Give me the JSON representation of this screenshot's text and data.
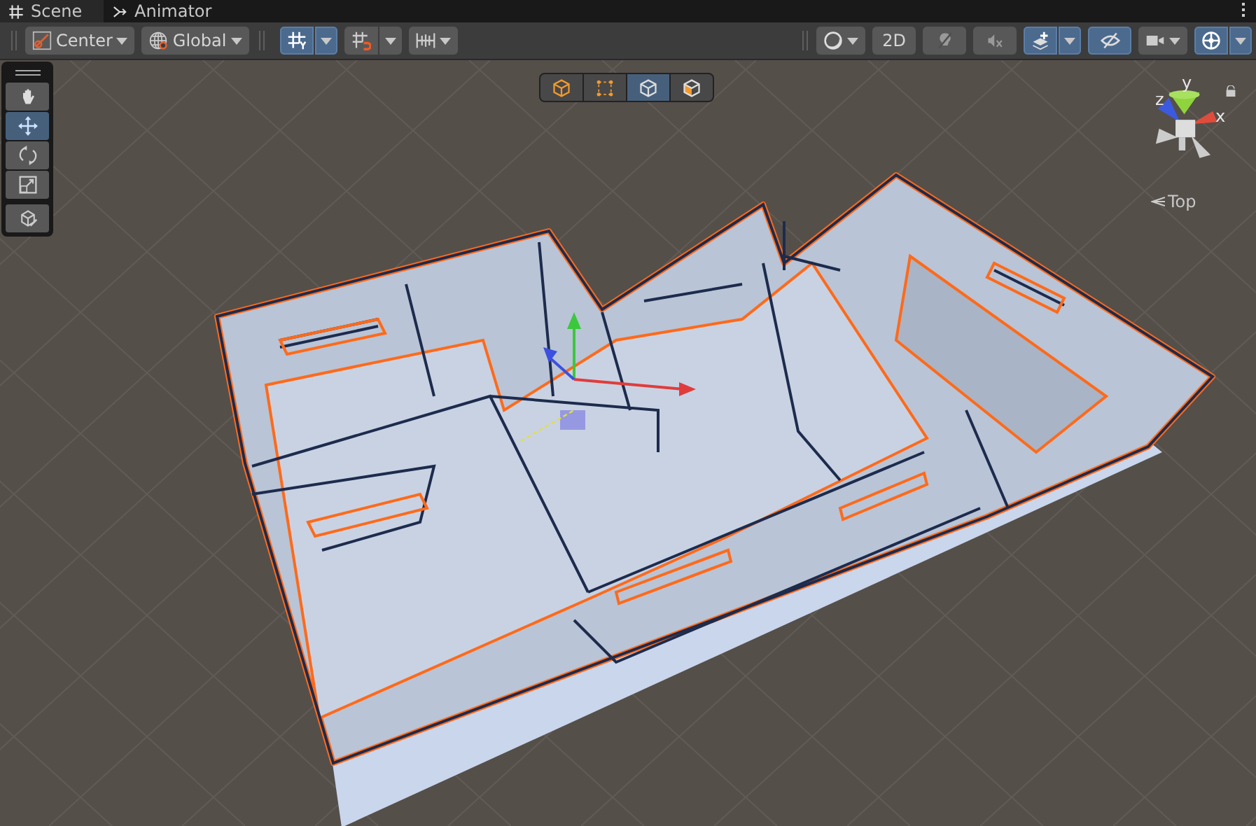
{
  "tabs": [
    {
      "label": "Scene",
      "selected": true
    },
    {
      "label": "Animator",
      "selected": false
    }
  ],
  "toolbar": {
    "left": [
      {
        "kind": "dropdown",
        "label": "Center"
      },
      {
        "kind": "dropdown",
        "label": "Global"
      },
      {
        "kind": "split",
        "selected": true
      },
      {
        "kind": "split",
        "selected": false
      },
      {
        "kind": "dropdown"
      }
    ],
    "right": [
      {
        "kind": "dropdown"
      },
      {
        "kind": "toggle",
        "label": "2D",
        "selected": false
      },
      {
        "kind": "toggle",
        "selected": false
      },
      {
        "kind": "toggle",
        "selected": false
      },
      {
        "kind": "split",
        "selected": true
      },
      {
        "kind": "toggle",
        "selected": true
      },
      {
        "kind": "dropdown"
      },
      {
        "kind": "split",
        "selected": true
      }
    ]
  },
  "tools": [
    {
      "selected": false
    },
    {
      "selected": true
    },
    {
      "selected": false
    },
    {
      "selected": false
    },
    {
      "selected": false
    }
  ],
  "overlay_modes": [
    {
      "selected": false
    },
    {
      "selected": false
    },
    {
      "selected": true
    },
    {
      "selected": false
    }
  ],
  "orientation_gizmo": {
    "axis_labels": [
      "y",
      "z",
      "x"
    ],
    "view_label": "Top"
  }
}
